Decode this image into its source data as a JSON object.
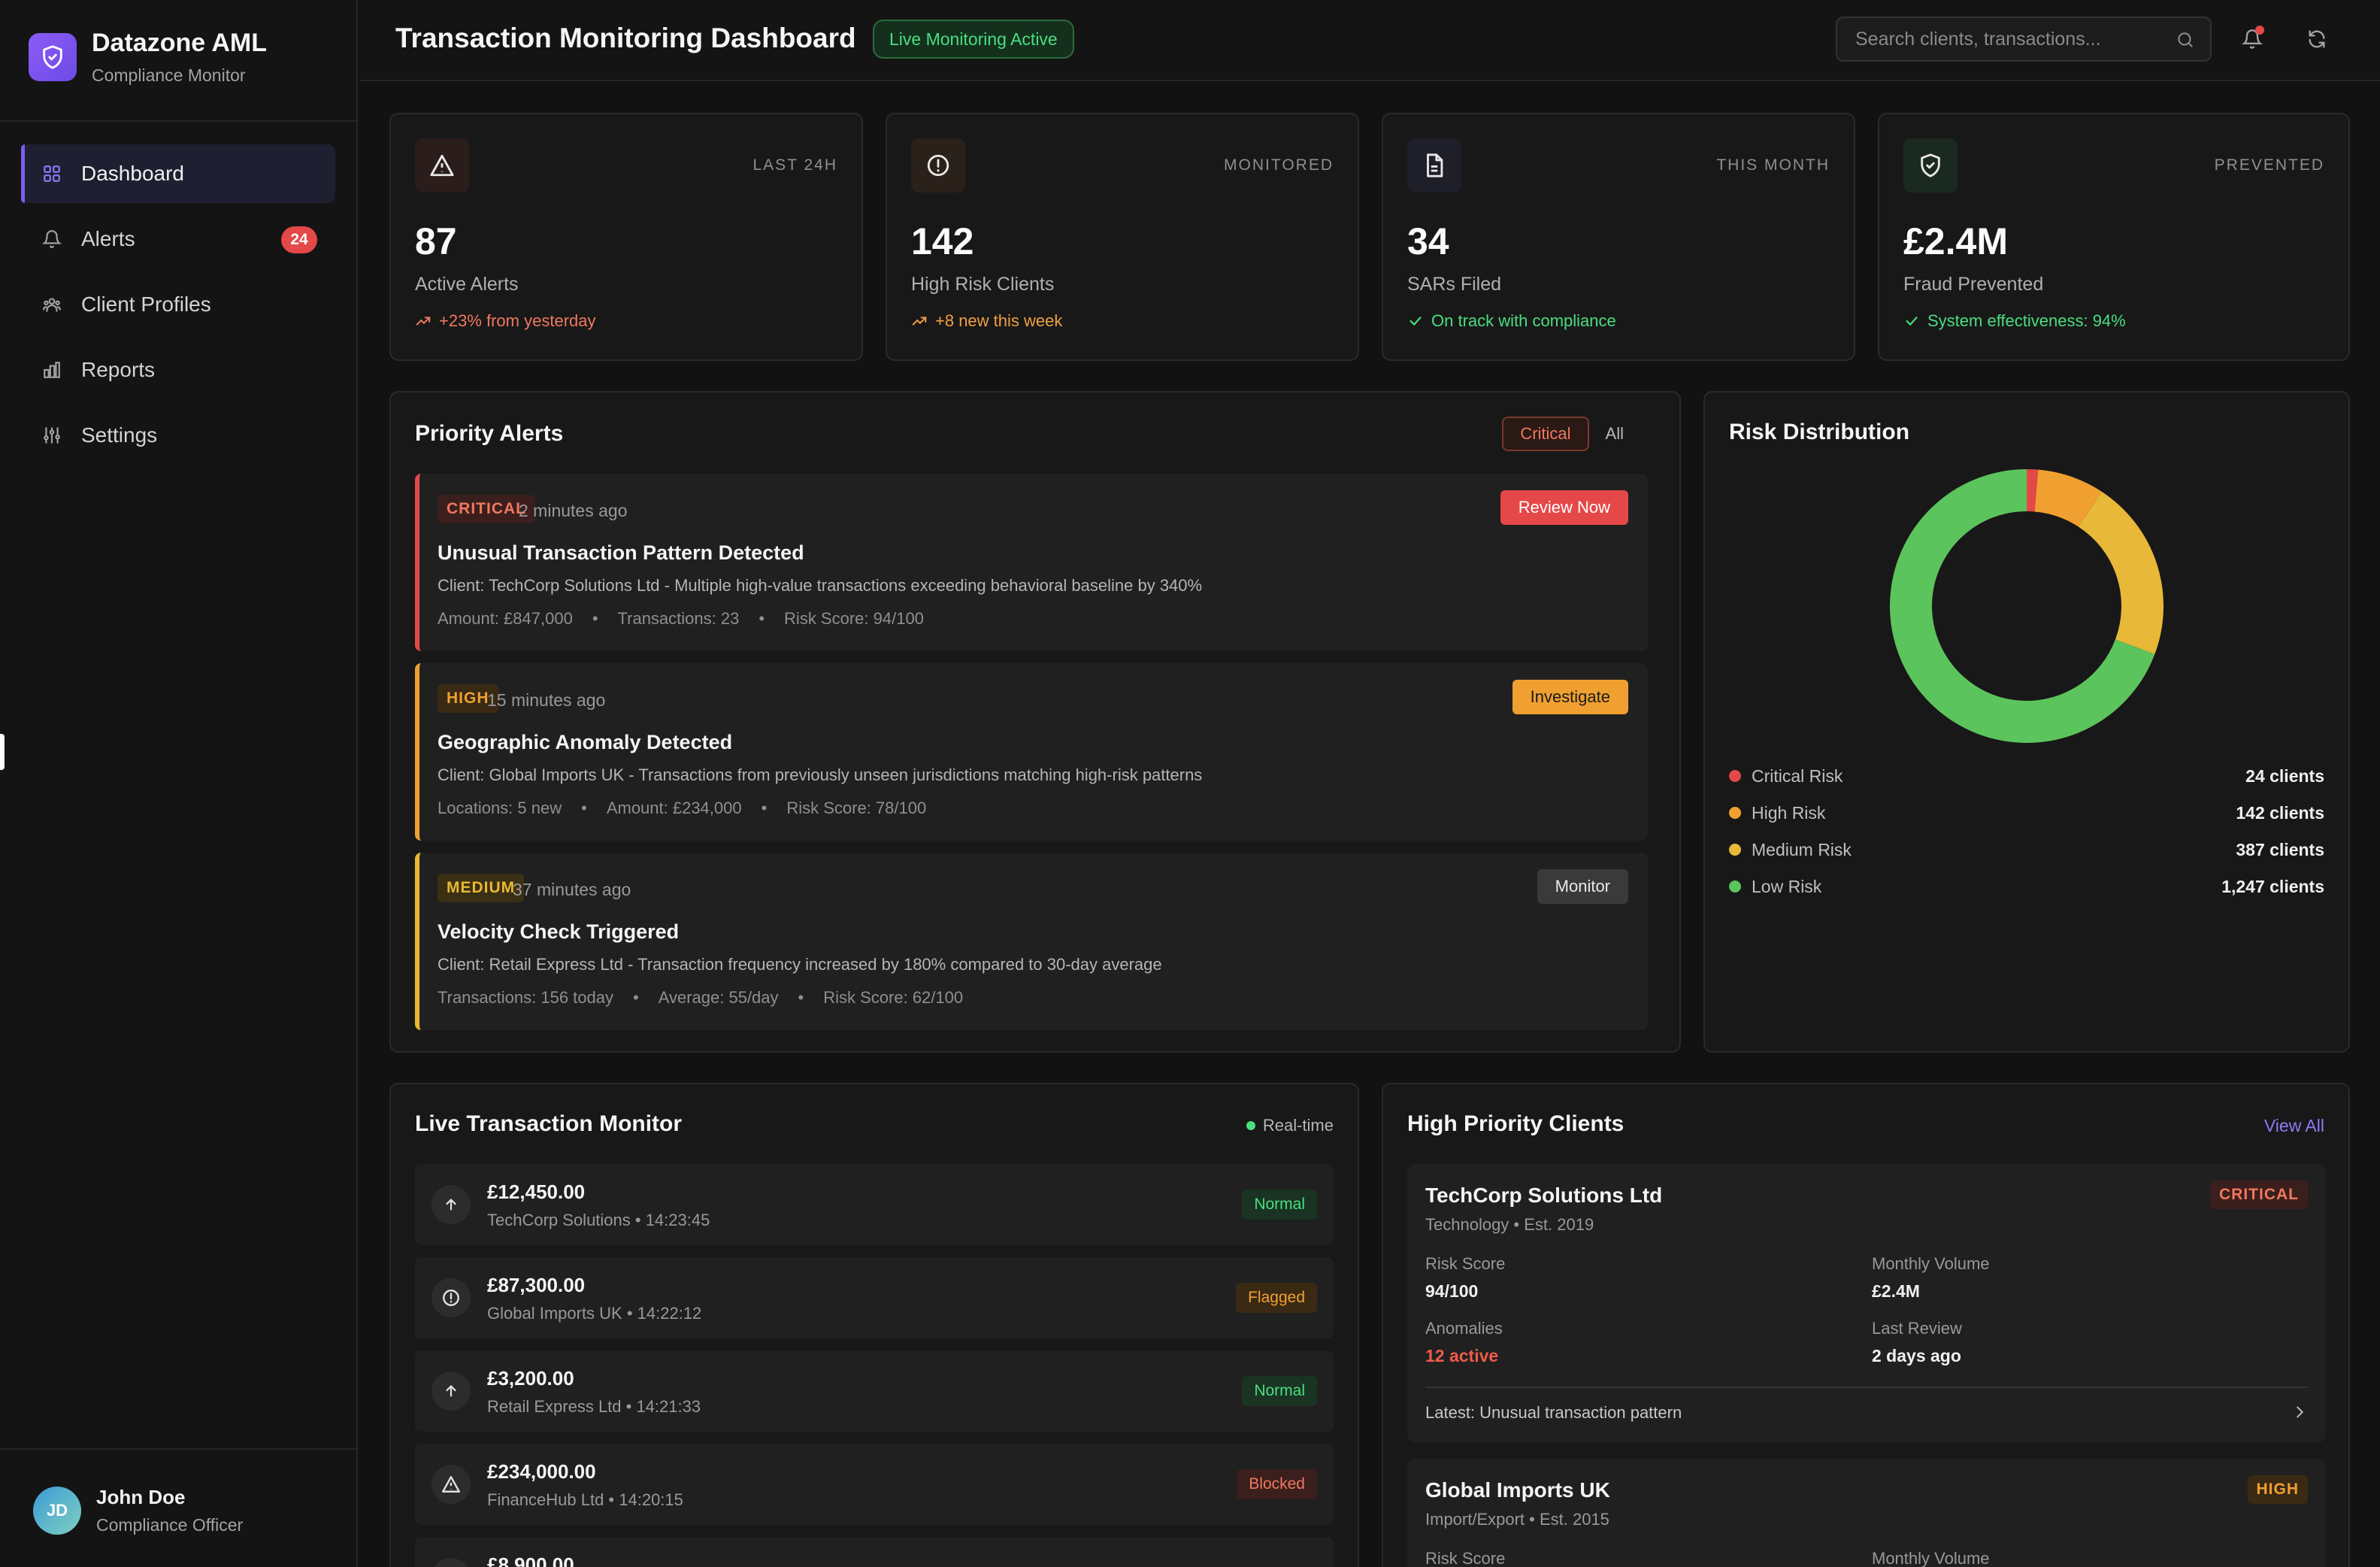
{
  "brand": {
    "title": "Datazone AML",
    "subtitle": "Compliance Monitor"
  },
  "nav": {
    "items": [
      {
        "label": "Dashboard",
        "icon": "grid-icon",
        "active": true
      },
      {
        "label": "Alerts",
        "icon": "bell-icon",
        "badge": "24"
      },
      {
        "label": "Client Profiles",
        "icon": "users-icon"
      },
      {
        "label": "Reports",
        "icon": "bar-chart-icon"
      },
      {
        "label": "Settings",
        "icon": "sliders-icon"
      }
    ]
  },
  "user": {
    "initials": "JD",
    "name": "John Doe",
    "role": "Compliance Officer"
  },
  "header": {
    "title": "Transaction Monitoring Dashboard",
    "live_badge": "Live Monitoring Active",
    "search_placeholder": "Search clients, transactions..."
  },
  "stats": [
    {
      "tag": "LAST 24H",
      "value": "87",
      "label": "Active Alerts",
      "trend": "+23% from yesterday",
      "trend_color": "#f07860",
      "icon": "alert-triangle-icon",
      "icon_bg": "#2a1d1b"
    },
    {
      "tag": "MONITORED",
      "value": "142",
      "label": "High Risk Clients",
      "trend": "+8 new this week",
      "trend_color": "#f0a040",
      "icon": "alert-circle-icon",
      "icon_bg": "#2a211b"
    },
    {
      "tag": "THIS MONTH",
      "value": "34",
      "label": "SARs Filed",
      "trend": "On track with compliance",
      "trend_color": "#4ade80",
      "icon": "file-icon",
      "icon_bg": "#1f1f2a"
    },
    {
      "tag": "PREVENTED",
      "value": "£2.4M",
      "label": "Fraud Prevented",
      "trend": "System effectiveness: 94%",
      "trend_color": "#4ade80",
      "icon": "shield-check-icon",
      "icon_bg": "#1b2a20"
    }
  ],
  "priority_alerts": {
    "title": "Priority Alerts",
    "filters": [
      "Critical",
      "All"
    ],
    "items": [
      {
        "severity": "CRITICAL",
        "time": "2 minutes ago",
        "title": "Unusual Transaction Pattern Detected",
        "desc": "Client: TechCorp Solutions Ltd - Multiple high-value transactions exceeding behavioral baseline by 340%",
        "meta": [
          "Amount: £847,000",
          "Transactions: 23",
          "Risk Score: 94/100"
        ],
        "action": "Review Now",
        "color": "#e54848"
      },
      {
        "severity": "HIGH",
        "time": "15 minutes ago",
        "title": "Geographic Anomaly Detected",
        "desc": "Client: Global Imports UK - Transactions from previously unseen jurisdictions matching high-risk patterns",
        "meta": [
          "Locations: 5 new",
          "Amount: £234,000",
          "Risk Score: 78/100"
        ],
        "action": "Investigate",
        "color": "#f0a030"
      },
      {
        "severity": "MEDIUM",
        "time": "37 minutes ago",
        "title": "Velocity Check Triggered",
        "desc": "Client: Retail Express Ltd - Transaction frequency increased by 180% compared to 30-day average",
        "meta": [
          "Transactions: 156 today",
          "Average: 55/day",
          "Risk Score: 62/100"
        ],
        "action": "Monitor",
        "color": "#e8b830"
      }
    ]
  },
  "risk_distribution": {
    "title": "Risk Distribution",
    "items": [
      {
        "label": "Critical Risk",
        "value_label": "24 clients",
        "count": 24,
        "color": "#e54848"
      },
      {
        "label": "High Risk",
        "value_label": "142 clients",
        "count": 142,
        "color": "#f0a030"
      },
      {
        "label": "Medium Risk",
        "value_label": "387 clients",
        "count": 387,
        "color": "#e8b838"
      },
      {
        "label": "Low Risk",
        "value_label": "1,247 clients",
        "count": 1247,
        "color": "#5cc45c"
      }
    ]
  },
  "chart_data": {
    "type": "pie",
    "categories": [
      "Critical Risk",
      "High Risk",
      "Medium Risk",
      "Low Risk"
    ],
    "values": [
      24,
      142,
      387,
      1247
    ],
    "title": "Risk Distribution"
  },
  "live_monitor": {
    "title": "Live Transaction Monitor",
    "realtime": "Real-time",
    "items": [
      {
        "amount": "£12,450.00",
        "meta": "TechCorp Solutions • 14:23:45",
        "status": "Normal",
        "icon": "arrow-up-icon"
      },
      {
        "amount": "£87,300.00",
        "meta": "Global Imports UK • 14:22:12",
        "status": "Flagged",
        "icon": "alert-circle-icon"
      },
      {
        "amount": "£3,200.00",
        "meta": "Retail Express Ltd • 14:21:33",
        "status": "Normal",
        "icon": "arrow-up-icon"
      },
      {
        "amount": "£234,000.00",
        "meta": "FinanceHub Ltd • 14:20:15",
        "status": "Blocked",
        "icon": "alert-triangle-icon"
      },
      {
        "amount": "£8,900.00",
        "meta": "",
        "status": "",
        "icon": "arrow-up-icon"
      }
    ]
  },
  "high_priority_clients": {
    "title": "High Priority Clients",
    "view_all": "View All",
    "clients": [
      {
        "name": "TechCorp Solutions Ltd",
        "sub": "Technology • Est. 2019",
        "severity": "CRITICAL",
        "risk_label": "Risk Score",
        "risk": "94/100",
        "volume_label": "Monthly Volume",
        "volume": "£2.4M",
        "anomalies_label": "Anomalies",
        "anomalies": "12 active",
        "review_label": "Last Review",
        "review": "2 days ago",
        "latest": "Latest: Unusual transaction pattern"
      },
      {
        "name": "Global Imports UK",
        "sub": "Import/Export • Est. 2015",
        "severity": "HIGH",
        "risk_label": "Risk Score",
        "volume_label": "Monthly Volume"
      }
    ]
  }
}
